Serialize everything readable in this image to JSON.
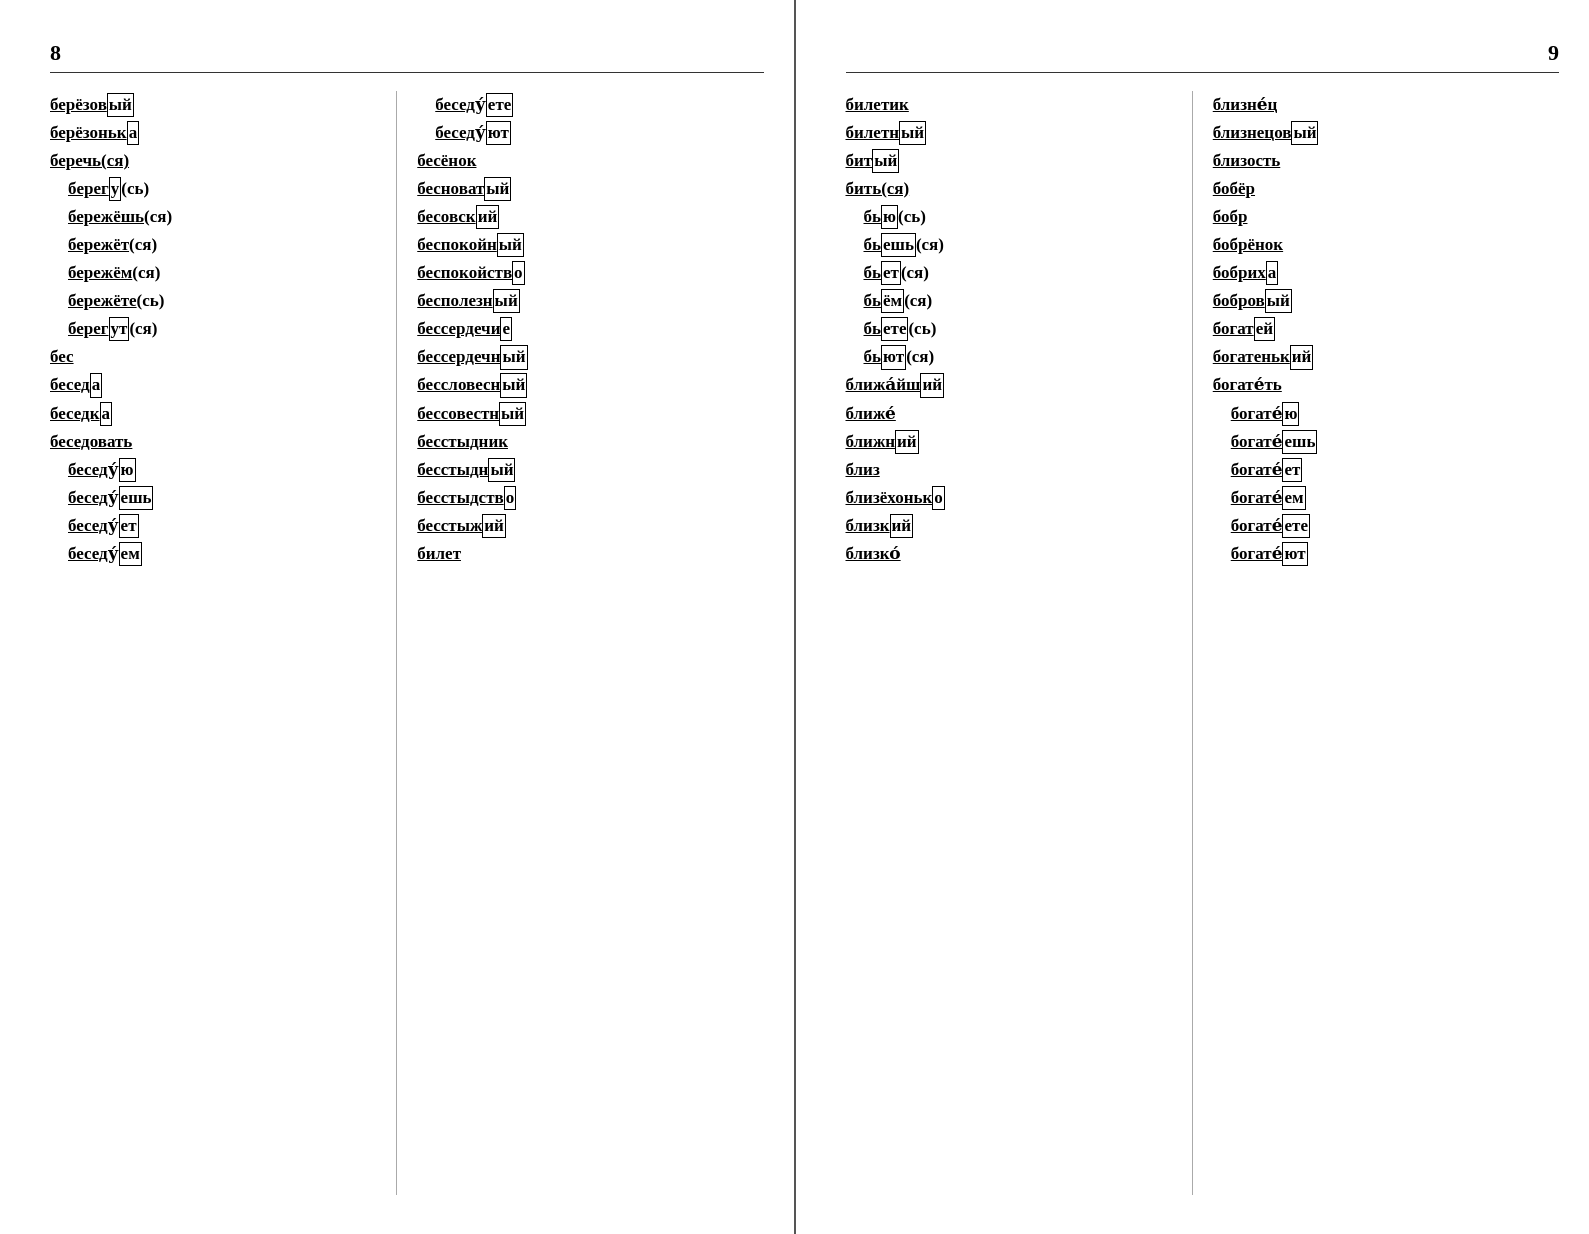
{
  "left_page": {
    "number": "8",
    "col1": [
      "берёзов|ый",
      "берёзоньк|а",
      "беречь(ся)",
      "бeрег|у|(сь)",
      "бережёшь|(ся)",
      "бережёт|(ся)",
      "бережём|(ся)",
      "бережёте|(сь)",
      "берег|ут|(ся)",
      "бес",
      "бесед|а",
      "беседк|а",
      "беседовать",
      "беседу́ю",
      "беседу́ешь",
      "беседу́ет",
      "беседу́ем"
    ],
    "col2": [
      "беседу́ете",
      "беседу́ют",
      "бесёнок",
      "бесноват|ый",
      "бесовск|ий",
      "беспокойн|ый",
      "беспокойств|о",
      "бесполезн|ый",
      "бессердечи|е",
      "бессердечн|ый",
      "бессловесн|ый",
      "бессовестн|ый",
      "бесстыдник",
      "бесстыдн|ый",
      "бесстыдств|о",
      "бесстыж|ий",
      "билет"
    ]
  },
  "right_page": {
    "number": "9",
    "col1": [
      "билетик",
      "билетн|ый",
      "бит|ый",
      "бить(ся)",
      "бь|ю|(сь)",
      "бь|ешь|(ся)",
      "бь|ет|(ся)",
      "бь|ём|(ся)",
      "бь|ете|(сь)",
      "бь|ют|(ся)",
      "ближайш|ий",
      "ближе́",
      "ближн|ий",
      "близ",
      "близёхоньк|о",
      "близк|ий",
      "близко́"
    ],
    "col2": [
      "близне́ц",
      "близнецов|ый",
      "близость",
      "бобёр",
      "бобр",
      "бобрёнок",
      "бобрих|а",
      "бобров|ый",
      "богат|ей",
      "богатеньк|ий",
      "богате́ть",
      "богате́ю",
      "богате́ешь",
      "богате́ет",
      "богате́ем",
      "богате́ете",
      "богате́ют"
    ]
  }
}
